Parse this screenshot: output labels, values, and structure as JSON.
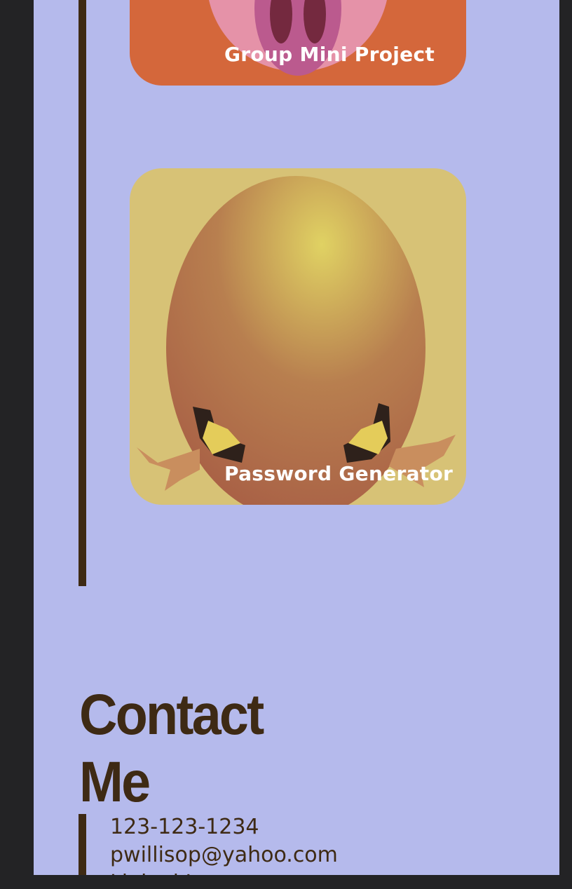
{
  "projects": [
    {
      "title": "Group Mini Project",
      "image": "pig-snout-image"
    },
    {
      "title": "Password Generator",
      "image": "cracked-egg-with-chicken-feet-image"
    }
  ],
  "contact": {
    "heading": "Contact Me",
    "phone": "123-123-1234",
    "email": "pwillisop@yahoo.com",
    "partial_line": "Linked In"
  },
  "colors": {
    "page_background": "#b5baec",
    "outer_background": "#232325",
    "accent_brown": "#3e2a14",
    "pig_card": "#d4673b",
    "egg_card": "#d7c276"
  }
}
